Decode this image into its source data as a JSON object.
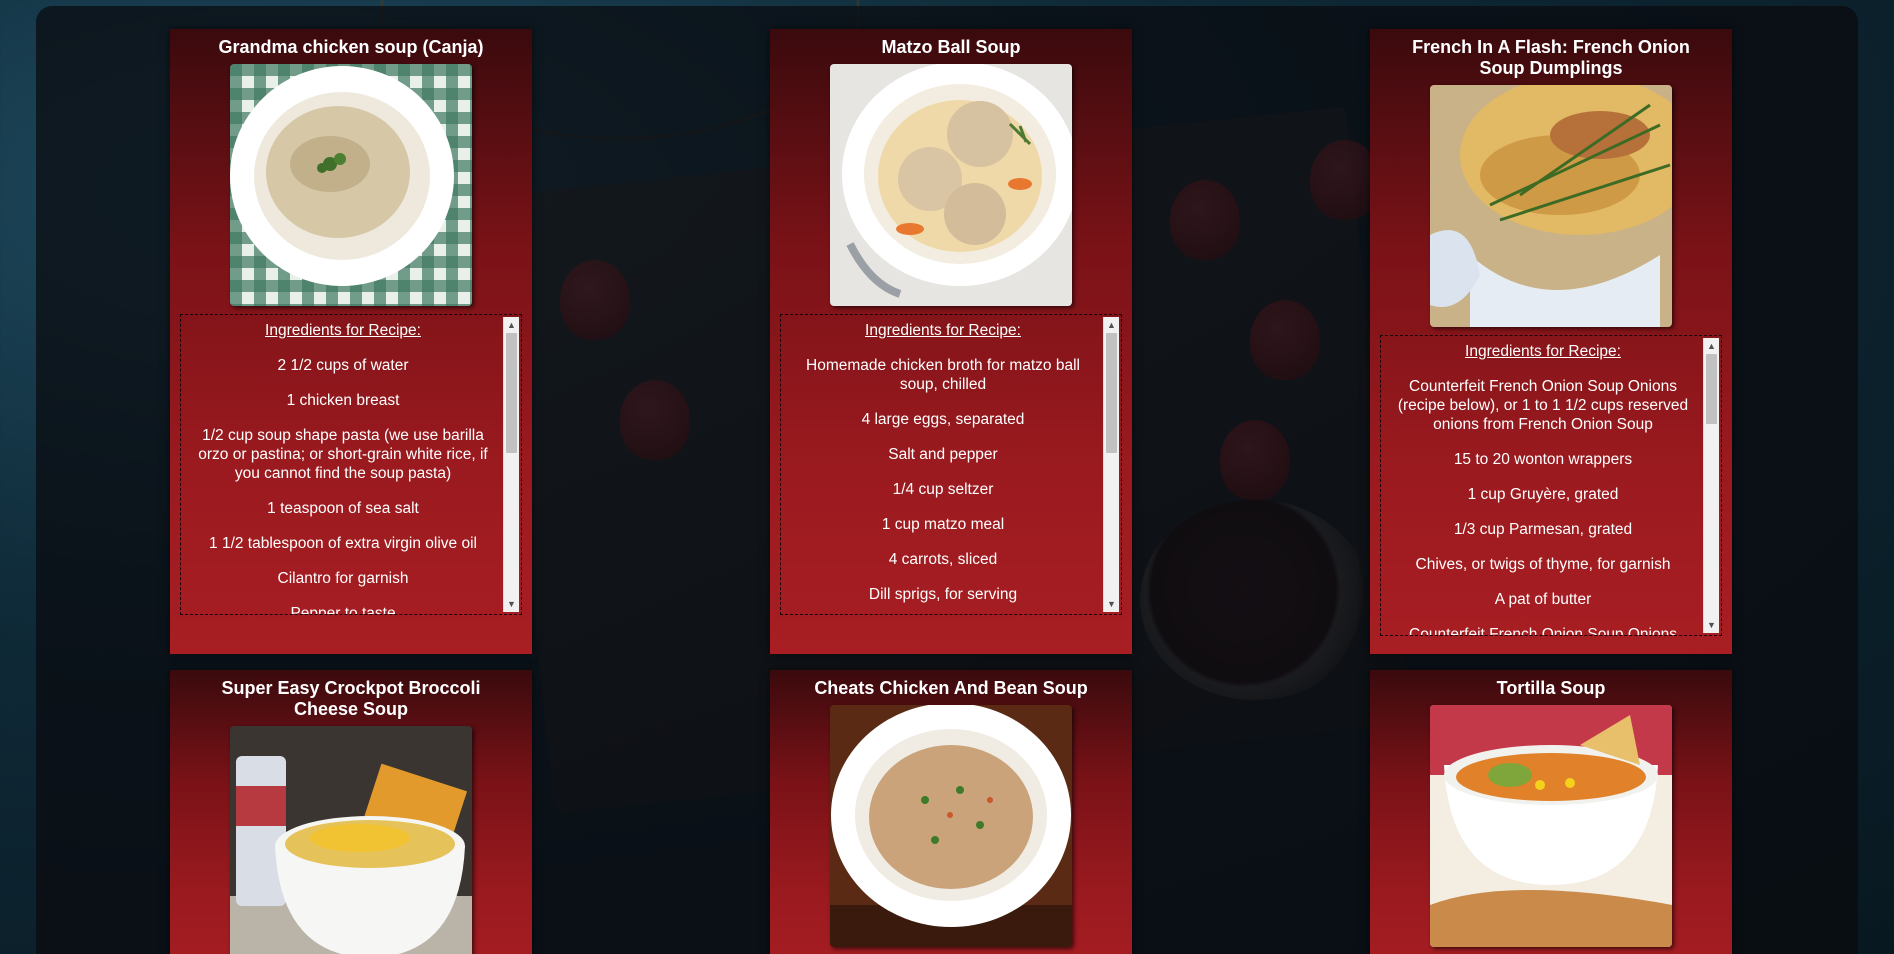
{
  "page": {
    "ingredients_heading": "Ingredients for Recipe:"
  },
  "cards": [
    {
      "title": "Grandma chicken soup (Canja)",
      "image": "chicken-soup-photo",
      "ingredients": [
        "2 1/2 cups of water",
        "1 chicken breast",
        "1/2 cup soup shape pasta (we use barilla orzo or pastina; or short-grain white rice, if you cannot find the soup pasta)",
        "1 teaspoon of sea salt",
        "1 1/2 tablespoon of extra virgin olive oil",
        "Cilantro for garnish",
        "Pepper to taste"
      ]
    },
    {
      "title": "Matzo Ball Soup",
      "image": "matzo-ball-soup-photo",
      "ingredients": [
        "Homemade chicken broth for matzo ball soup, chilled",
        "4 large eggs, separated",
        "Salt and pepper",
        "1/4 cup seltzer",
        "1 cup matzo meal",
        "4 carrots, sliced",
        "Dill sprigs, for serving"
      ]
    },
    {
      "title": "French In A Flash: French Onion Soup Dumplings",
      "image": "onion-soup-dumplings-photo",
      "ingredients": [
        "Counterfeit French Onion Soup Onions (recipe below), or 1 to 1 1/2 cups reserved onions from French Onion Soup",
        "15 to 20 wonton wrappers",
        "1 cup Gruyère, grated",
        "1/3 cup Parmesan, grated",
        "Chives, or twigs of thyme, for garnish",
        "A pat of butter",
        "Counterfeit French Onion Soup Onions"
      ]
    },
    {
      "title": "Super Easy Crockpot Broccoli Cheese Soup",
      "image": "broccoli-cheese-soup-photo"
    },
    {
      "title": "Cheats Chicken And Bean Soup",
      "image": "chicken-bean-soup-photo"
    },
    {
      "title": "Tortilla Soup",
      "image": "tortilla-soup-photo"
    }
  ]
}
